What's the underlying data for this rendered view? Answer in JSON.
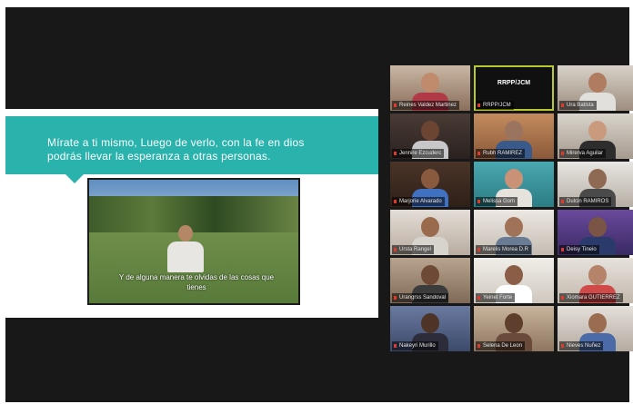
{
  "slide": {
    "banner_text": "Mírate a ti mismo, Luego de verlo, con la fe en dios podrás llevar la esperanza a otras personas.",
    "video_caption": "Y de alguna manera te olvidas de las cosas que tienes",
    "accent_color": "#2ab3ad"
  },
  "gallery": {
    "active_label": "RRPP/JCM",
    "participants": [
      {
        "name": "Reines Valdez Martinez",
        "icon": "video-off-icon"
      },
      {
        "name": "RRPP/JCM",
        "icon": "video-off-icon"
      },
      {
        "name": "Ura Batista",
        "icon": "video-off-icon"
      },
      {
        "name": "Jennire Ezcuderc",
        "icon": "video-off-icon"
      },
      {
        "name": "Rubh RAMIREZ",
        "icon": "video-off-icon"
      },
      {
        "name": "Mirerva Aguilar",
        "icon": "video-off-icon"
      },
      {
        "name": "Marjorie Alvarado",
        "icon": "video-off-icon"
      },
      {
        "name": "Melissa Gom",
        "icon": "video-off-icon"
      },
      {
        "name": "Dulcin RAMIROS",
        "icon": "video-off-icon"
      },
      {
        "name": "Ursta Rangel",
        "icon": "video-off-icon"
      },
      {
        "name": "Marelis Morea D.R",
        "icon": "video-off-icon"
      },
      {
        "name": "Deisy Tineio",
        "icon": "video-off-icon"
      },
      {
        "name": "Urangrss Sandoval",
        "icon": "video-off-icon"
      },
      {
        "name": "Yeinet Forte",
        "icon": "video-off-icon"
      },
      {
        "name": "Xiomara GUTIERREZ",
        "icon": "video-off-icon"
      },
      {
        "name": "Nakeyri Murillo",
        "icon": "video-off-icon"
      },
      {
        "name": "Selena De Leon",
        "icon": "video-off-icon"
      },
      {
        "name": "Nieves Nuñez",
        "icon": "video-off-icon"
      }
    ]
  }
}
